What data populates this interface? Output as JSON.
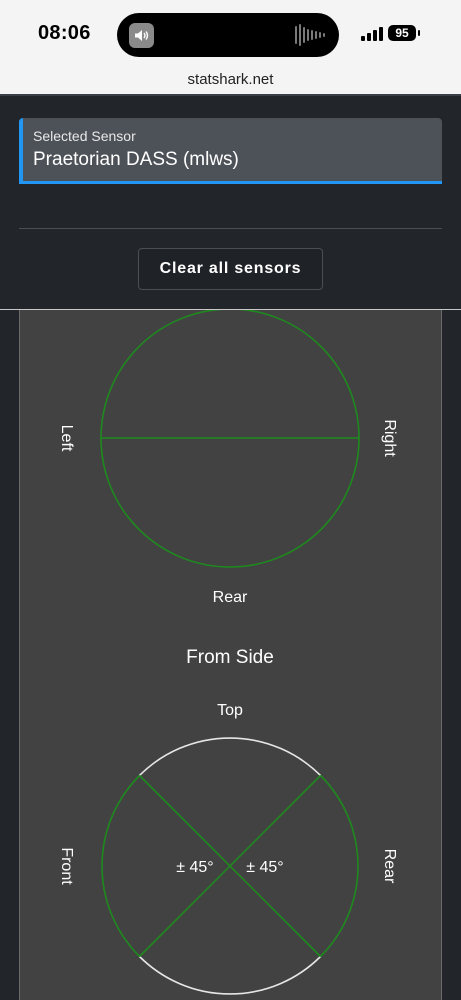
{
  "status_bar": {
    "time": "08:06",
    "battery": "95",
    "speaker_icon": "speaker-icon",
    "signal_icon": "cellular-signal-icon"
  },
  "browser": {
    "url": "statshark.net"
  },
  "sensor_select": {
    "label": "Selected Sensor",
    "value": "Praetorian DASS (mlws)"
  },
  "actions": {
    "clear_label": "Clear all sensors"
  },
  "diagram": {
    "top_view": {
      "left_label": "Left",
      "right_label": "Right",
      "rear_label": "Rear"
    },
    "side_view": {
      "title": "From Side",
      "top_label": "Top",
      "front_label": "Front",
      "rear_label": "Rear",
      "front_angle": "± 45°",
      "rear_angle": "± 45°"
    }
  },
  "colors": {
    "accent": "#2196f3",
    "coverage": "#1e8a1e",
    "no_coverage": "#e6e6e6",
    "panel": "#424242",
    "background": "#22252a"
  }
}
